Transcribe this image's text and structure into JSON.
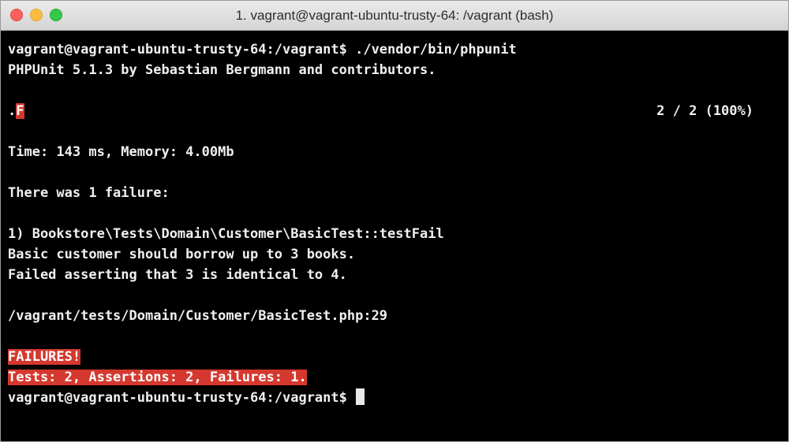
{
  "window": {
    "title": "1. vagrant@vagrant-ubuntu-trusty-64: /vagrant (bash)"
  },
  "terminal": {
    "prompt_command": "vagrant@vagrant-ubuntu-trusty-64:/vagrant$ ./vendor/bin/phpunit",
    "version_line": "PHPUnit 5.1.3 by Sebastian Bergmann and contributors.",
    "progress_pass": ".",
    "progress_fail": "F",
    "progress_count": "2 / 2 (100%)",
    "time_memory": "Time: 143 ms, Memory: 4.00Mb",
    "failure_header": "There was 1 failure:",
    "failure_test": "1) Bookstore\\Tests\\Domain\\Customer\\BasicTest::testFail",
    "failure_message": "Basic customer should borrow up to 3 books.",
    "failure_assertion": "Failed asserting that 3 is identical to 4.",
    "failure_location": "/vagrant/tests/Domain/Customer/BasicTest.php:29",
    "summary_title": "FAILURES!",
    "summary_counts": "Tests: 2, Assertions: 2, Failures: 1.",
    "final_prompt": "vagrant@vagrant-ubuntu-trusty-64:/vagrant$ "
  },
  "colors": {
    "background": "#000000",
    "text": "#f0f0f0",
    "failure_highlight": "#d5382e"
  }
}
